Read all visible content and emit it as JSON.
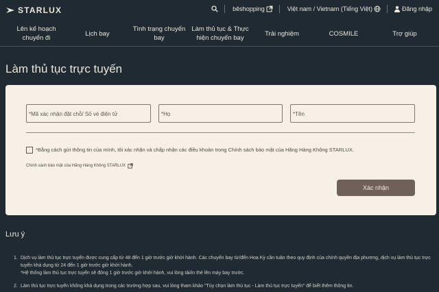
{
  "header": {
    "brand": "STARLUX",
    "shop_label": "bêshopping",
    "language_label": "Việt nam / Vietnam (Tiếng Việt)",
    "login_label": "Đăng nhập",
    "icons": [
      "search-icon",
      "external-link-icon",
      "globe-icon",
      "user-icon"
    ]
  },
  "nav": {
    "items": [
      {
        "label": "Lên kế hoạch chuyến đi"
      },
      {
        "label": "Lịch bay"
      },
      {
        "label": "Tình trạng chuyến bay"
      },
      {
        "label": "Làm thủ tục & Thực hiện chuyến bay"
      },
      {
        "label": "Trải nghiệm"
      },
      {
        "label": "COSMILE"
      },
      {
        "label": "Trợ giúp"
      }
    ]
  },
  "page": {
    "title": "Làm thủ tục trực tuyến"
  },
  "form": {
    "booking_placeholder": "*Mã xác nhận đặt chỗ/ Số vé điện tử",
    "lastname_placeholder": "*Họ",
    "firstname_placeholder": "*Tên",
    "consent_text": "*Bằng cách gửi thông tin của mình, tôi xác nhận và chấp nhận các điều khoản trong Chính sách bảo mật của Hãng Hàng Không STARLUX.",
    "consent_checked": false,
    "policy_link": "Chính sách bảo mật của Hãng Hàng Không STARLUX",
    "submit_label": "Xác nhận"
  },
  "notes": {
    "title": "Lưu ý",
    "items": [
      {
        "num": "1.",
        "text": "Dịch vụ làm thủ tục trực tuyến được cung cấp từ 48 đến 1 giờ trước giờ khởi hành. Các chuyến bay từ/đến Hoa Kỳ cần tuân theo quy định của chính quyền địa phương, dịch vụ làm thủ tục trực tuyến khả dụng từ 24 đến 1 giờ trước giờ khởi hành.",
        "sub": "*Hệ thống làm thủ tục trực tuyến sẽ đóng 1 giờ trước giờ khởi hành, vui lòng tải/in thẻ lên máy bay trước."
      },
      {
        "num": "2.",
        "text": "Làm thủ tục trực tuyến không khả dụng trong các trường hợp sau, vui lòng tham khảo \"Tùy chọn làm thủ tục - Làm thủ tục trực tuyến\" để biết thêm thông tin.",
        "sub": ""
      }
    ]
  },
  "colors": {
    "background": "#1f2a33",
    "card": "#f6f0e6",
    "button": "#6f6159"
  }
}
